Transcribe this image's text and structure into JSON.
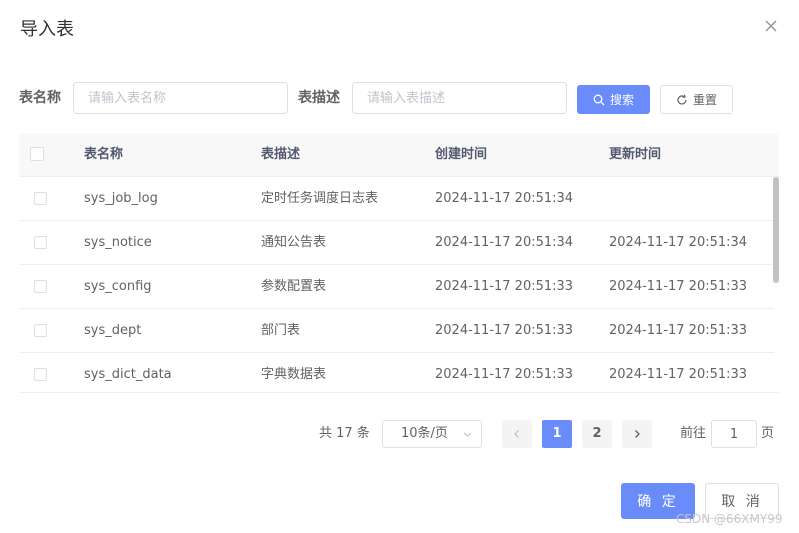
{
  "dialog": {
    "title": "导入表",
    "close_icon": "close-icon"
  },
  "filters": {
    "table_name_label": "表名称",
    "table_name_placeholder": "请输入表名称",
    "table_name_value": "",
    "table_desc_label": "表描述",
    "table_desc_placeholder": "请输入表描述",
    "table_desc_value": "",
    "search_label": "搜索",
    "search_icon": "search-icon",
    "reset_label": "重置",
    "reset_icon": "refresh-icon"
  },
  "table": {
    "columns": [
      "表名称",
      "表描述",
      "创建时间",
      "更新时间"
    ],
    "rows": [
      {
        "name": "sys_job_log",
        "desc": "定时任务调度日志表",
        "created": "2024-11-17 20:51:34",
        "updated": ""
      },
      {
        "name": "sys_notice",
        "desc": "通知公告表",
        "created": "2024-11-17 20:51:34",
        "updated": "2024-11-17 20:51:34"
      },
      {
        "name": "sys_config",
        "desc": "参数配置表",
        "created": "2024-11-17 20:51:33",
        "updated": "2024-11-17 20:51:33"
      },
      {
        "name": "sys_dept",
        "desc": "部门表",
        "created": "2024-11-17 20:51:33",
        "updated": "2024-11-17 20:51:33"
      },
      {
        "name": "sys_dict_data",
        "desc": "字典数据表",
        "created": "2024-11-17 20:51:33",
        "updated": "2024-11-17 20:51:33"
      }
    ]
  },
  "pagination": {
    "total_text": "共 17 条",
    "page_size": "10条/页",
    "pages": [
      "1",
      "2"
    ],
    "current_page": "1",
    "goto_label": "前往",
    "goto_value": "1",
    "goto_suffix": "页"
  },
  "footer": {
    "confirm_label": "确 定",
    "cancel_label": "取 消"
  },
  "watermark": "CSDN @66XMY99",
  "colors": {
    "primary": "#6a8cfb",
    "border": "#dcdfe6",
    "header_bg": "#f8f8f9"
  }
}
